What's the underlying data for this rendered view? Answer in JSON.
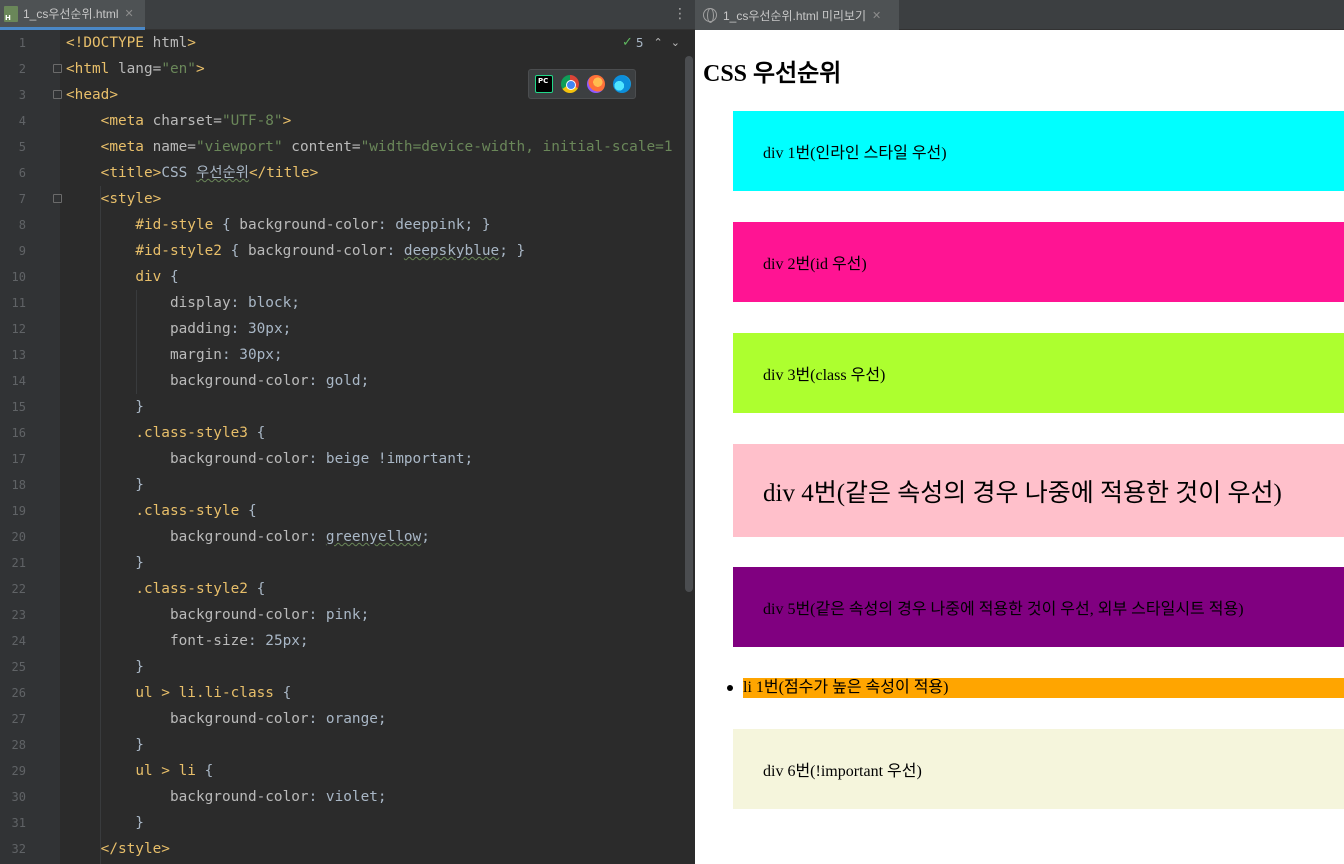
{
  "editor": {
    "tab_label": "1_cs우선순위.html",
    "tab_close": "✕",
    "file_icon_letter": "H",
    "menu_glyph": "⋮",
    "inspection_count": "5",
    "inspection_icon": "check-icon",
    "nav_arrows": "⌃⌄",
    "browser_popup": [
      "pycharm-icon",
      "chrome-icon",
      "firefox-icon",
      "edge-icon"
    ],
    "browser_popup_pc_text": "PC",
    "line_numbers": [
      "1",
      "2",
      "3",
      "4",
      "5",
      "6",
      "7",
      "8",
      "9",
      "10",
      "11",
      "12",
      "13",
      "14",
      "15",
      "16",
      "17",
      "18",
      "19",
      "20",
      "21",
      "22",
      "23",
      "24",
      "25",
      "26",
      "27",
      "28",
      "29",
      "30",
      "31",
      "32"
    ],
    "lines": [
      [
        {
          "t": "doctype",
          "s": "<!DOCTYPE "
        },
        {
          "t": "attr",
          "s": "html"
        },
        {
          "t": "doctype",
          "s": ">"
        }
      ],
      [
        {
          "t": "tag",
          "s": "<html "
        },
        {
          "t": "attr",
          "s": "lang="
        },
        {
          "t": "str",
          "s": "\"en\""
        },
        {
          "t": "tag",
          "s": ">"
        }
      ],
      [
        {
          "t": "tag",
          "s": "<head>"
        }
      ],
      [
        {
          "t": "plain",
          "s": "    "
        },
        {
          "t": "tag",
          "s": "<meta "
        },
        {
          "t": "attr",
          "s": "charset="
        },
        {
          "t": "str",
          "s": "\"UTF-8\""
        },
        {
          "t": "tag",
          "s": ">"
        }
      ],
      [
        {
          "t": "plain",
          "s": "    "
        },
        {
          "t": "tag",
          "s": "<meta "
        },
        {
          "t": "attr",
          "s": "name="
        },
        {
          "t": "str",
          "s": "\"viewport\" "
        },
        {
          "t": "attr",
          "s": "content="
        },
        {
          "t": "str",
          "s": "\"width=device-width, initial-scale=1"
        }
      ],
      [
        {
          "t": "plain",
          "s": "    "
        },
        {
          "t": "tag",
          "s": "<title>"
        },
        {
          "t": "plain",
          "s": "CSS "
        },
        {
          "t": "squiggle",
          "s": "우선순위"
        },
        {
          "t": "tag",
          "s": "</title>"
        }
      ],
      [
        {
          "t": "plain",
          "s": "    "
        },
        {
          "t": "tag",
          "s": "<style>"
        }
      ],
      [
        {
          "t": "plain",
          "s": "        "
        },
        {
          "t": "sel",
          "s": "#id-style "
        },
        {
          "t": "plain",
          "s": "{ "
        },
        {
          "t": "prop",
          "s": "background-color"
        },
        {
          "t": "plain",
          "s": ": deeppink; }"
        }
      ],
      [
        {
          "t": "plain",
          "s": "        "
        },
        {
          "t": "sel",
          "s": "#id-style2 "
        },
        {
          "t": "plain",
          "s": "{ "
        },
        {
          "t": "prop",
          "s": "background-color"
        },
        {
          "t": "plain",
          "s": ": "
        },
        {
          "t": "squiggle",
          "s": "deepskyblue"
        },
        {
          "t": "plain",
          "s": "; }"
        }
      ],
      [
        {
          "t": "plain",
          "s": "        "
        },
        {
          "t": "sel",
          "s": "div "
        },
        {
          "t": "plain",
          "s": "{"
        }
      ],
      [
        {
          "t": "plain",
          "s": "            "
        },
        {
          "t": "prop",
          "s": "display"
        },
        {
          "t": "plain",
          "s": ": block;"
        }
      ],
      [
        {
          "t": "plain",
          "s": "            "
        },
        {
          "t": "prop",
          "s": "padding"
        },
        {
          "t": "plain",
          "s": ": 30px;"
        }
      ],
      [
        {
          "t": "plain",
          "s": "            "
        },
        {
          "t": "prop",
          "s": "margin"
        },
        {
          "t": "plain",
          "s": ": 30px;"
        }
      ],
      [
        {
          "t": "plain",
          "s": "            "
        },
        {
          "t": "prop",
          "s": "background-color"
        },
        {
          "t": "plain",
          "s": ": gold;"
        }
      ],
      [
        {
          "t": "plain",
          "s": "        }"
        }
      ],
      [
        {
          "t": "plain",
          "s": "        "
        },
        {
          "t": "sel",
          "s": ".class-style3 "
        },
        {
          "t": "plain",
          "s": "{"
        }
      ],
      [
        {
          "t": "plain",
          "s": "            "
        },
        {
          "t": "prop",
          "s": "background-color"
        },
        {
          "t": "plain",
          "s": ": beige !important;"
        }
      ],
      [
        {
          "t": "plain",
          "s": "        }"
        }
      ],
      [
        {
          "t": "plain",
          "s": "        "
        },
        {
          "t": "sel",
          "s": ".class-style "
        },
        {
          "t": "plain",
          "s": "{"
        }
      ],
      [
        {
          "t": "plain",
          "s": "            "
        },
        {
          "t": "prop",
          "s": "background-color"
        },
        {
          "t": "plain",
          "s": ": "
        },
        {
          "t": "squiggle",
          "s": "greenyellow"
        },
        {
          "t": "plain",
          "s": ";"
        }
      ],
      [
        {
          "t": "plain",
          "s": "        }"
        }
      ],
      [
        {
          "t": "plain",
          "s": "        "
        },
        {
          "t": "sel",
          "s": ".class-style2 "
        },
        {
          "t": "plain",
          "s": "{"
        }
      ],
      [
        {
          "t": "plain",
          "s": "            "
        },
        {
          "t": "prop",
          "s": "background-color"
        },
        {
          "t": "plain",
          "s": ": pink;"
        }
      ],
      [
        {
          "t": "plain",
          "s": "            "
        },
        {
          "t": "prop",
          "s": "font-size"
        },
        {
          "t": "plain",
          "s": ": 25px;"
        }
      ],
      [
        {
          "t": "plain",
          "s": "        }"
        }
      ],
      [
        {
          "t": "plain",
          "s": "        "
        },
        {
          "t": "sel",
          "s": "ul > li.li-class "
        },
        {
          "t": "plain",
          "s": "{"
        }
      ],
      [
        {
          "t": "plain",
          "s": "            "
        },
        {
          "t": "prop",
          "s": "background-color"
        },
        {
          "t": "plain",
          "s": ": orange;"
        }
      ],
      [
        {
          "t": "plain",
          "s": "        }"
        }
      ],
      [
        {
          "t": "plain",
          "s": "        "
        },
        {
          "t": "sel",
          "s": "ul > li "
        },
        {
          "t": "plain",
          "s": "{"
        }
      ],
      [
        {
          "t": "plain",
          "s": "            "
        },
        {
          "t": "prop",
          "s": "background-color"
        },
        {
          "t": "plain",
          "s": ": violet;"
        }
      ],
      [
        {
          "t": "plain",
          "s": "        }"
        }
      ],
      [
        {
          "t": "plain",
          "s": "    "
        },
        {
          "t": "tag",
          "s": "</style>"
        }
      ]
    ]
  },
  "preview": {
    "tab_label": "1_cs우선순위.html 미리보기",
    "tab_close": "✕",
    "heading": "CSS 우선순위",
    "boxes": [
      {
        "label": "div 1번(인라인 스타일 우선)",
        "color": "#00ffff"
      },
      {
        "label": "div 2번(id 우선)",
        "color": "#ff1493"
      },
      {
        "label": "div 3번(class 우선)",
        "color": "#adff2f"
      },
      {
        "label": "div 4번(같은 속성의 경우 나중에 적용한 것이 우선)",
        "color": "#ffc0cb"
      },
      {
        "label": "div 5번(같은 속성의 경우 나중에 적용한 것이 우선, 외부 스타일시트 적용)",
        "color": "#800080"
      },
      {
        "label": "div 6번(!important 우선)",
        "color": "#f5f5dc"
      }
    ],
    "list_item": {
      "label": "li 1번(점수가 높은 속성이 적용)",
      "color": "#ffa500"
    }
  }
}
